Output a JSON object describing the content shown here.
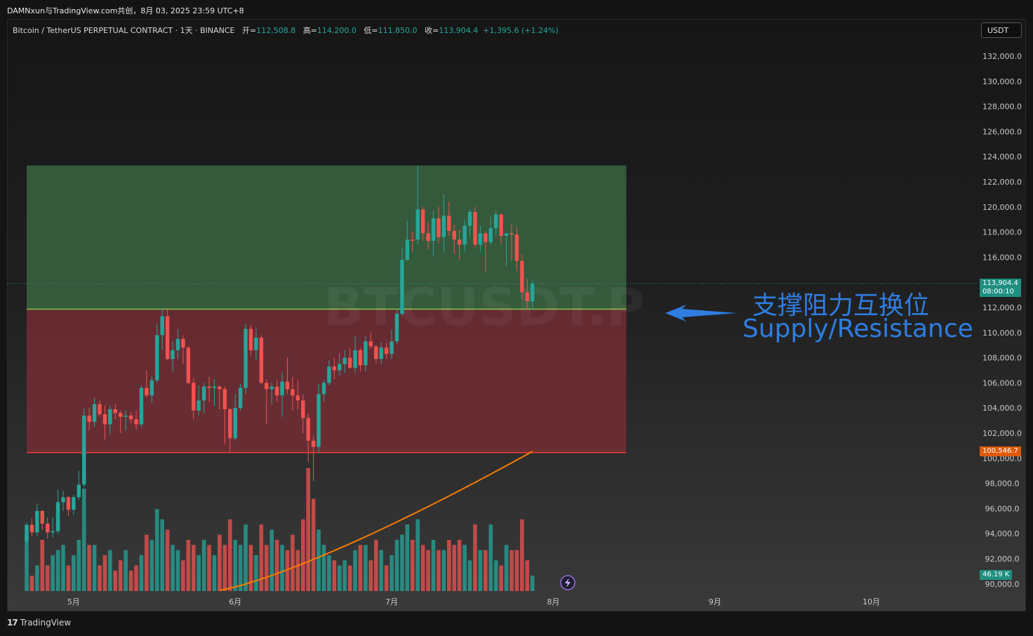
{
  "header": {
    "title": "DAMNxun与TradingView.com共创，8月 03, 2025 23:59 UTC+8"
  },
  "legend": {
    "symbol": "Bitcoin / TetherUS PERPETUAL CONTRACT · 1天 · BINANCE",
    "open_label": "开=",
    "open": "112,508.8",
    "high_label": "高=",
    "high": "114,200.0",
    "low_label": "低=",
    "low": "111,850.0",
    "close_label": "收=",
    "close": "113,904.4",
    "change": "+1,395.6 (+1.24%)"
  },
  "currency_button": "USDT",
  "watermark": "BTCUSDT.P",
  "annotation": {
    "cn": "支撑阻力互换位",
    "en": "Supply/Resistance"
  },
  "price_labels": {
    "last_price": "113,904.4",
    "countdown": "08:00:10",
    "ma_value": "100,546.7",
    "volume_value": "46.19 K"
  },
  "footer": {
    "brand": "TradingView",
    "logo": "17"
  },
  "colors": {
    "up": "#26a69a",
    "down": "#ef5350",
    "ma": "#f57c00",
    "supply_zone": "#3c6a44",
    "demand_zone": "#7a2e36",
    "annotation": "#2f7de1"
  },
  "chart_data": {
    "type": "candlestick",
    "interval": "1天",
    "y_axis": {
      "ticks": [
        "132,000.0",
        "130,000.0",
        "128,000.0",
        "126,000.0",
        "124,000.0",
        "122,000.0",
        "120,000.0",
        "118,000.0",
        "116,000.0",
        "114,000.0",
        "112,000.0",
        "110,000.0",
        "108,000.0",
        "106,000.0",
        "104,000.0",
        "102,000.0",
        "100,000.0",
        "98,000.0",
        "96,000.0",
        "94,000.0",
        "92,000.0",
        "90,000.0"
      ],
      "ylim": [
        89500,
        133500
      ]
    },
    "x_axis": {
      "ticks": [
        "5月",
        "6月",
        "7月",
        "8月",
        "9月",
        "10月"
      ]
    },
    "zones": [
      {
        "name": "upper",
        "top": 123300,
        "bottom": 111870,
        "start": "2025-04-22",
        "end": "2025-08-15"
      },
      {
        "name": "lower",
        "top": 111870,
        "bottom": 100450,
        "start": "2025-04-22",
        "end": "2025-08-15"
      }
    ],
    "start_date": "2025-04-22",
    "candles": [
      [
        93440,
        94860,
        93200,
        94700
      ],
      [
        94700,
        95200,
        93800,
        94100
      ],
      [
        94100,
        96400,
        93800,
        95800
      ],
      [
        95800,
        95900,
        94300,
        94800
      ],
      [
        94800,
        95300,
        93600,
        94100
      ],
      [
        94100,
        95300,
        93700,
        94200
      ],
      [
        94200,
        97500,
        94000,
        96500
      ],
      [
        96500,
        97400,
        95800,
        96900
      ],
      [
        96900,
        97000,
        95400,
        95900
      ],
      [
        95900,
        97100,
        95500,
        96900
      ],
      [
        96900,
        99000,
        96700,
        97900
      ],
      [
        97900,
        104000,
        97700,
        103400
      ],
      [
        103400,
        104000,
        102200,
        102900
      ],
      [
        102900,
        104800,
        102500,
        104300
      ],
      [
        104300,
        104600,
        103300,
        103500
      ],
      [
        103500,
        104200,
        101500,
        102700
      ],
      [
        102700,
        104200,
        101900,
        103900
      ],
      [
        103900,
        104300,
        103100,
        103600
      ],
      [
        103600,
        103800,
        102000,
        103300
      ],
      [
        103300,
        103800,
        102200,
        103400
      ],
      [
        103400,
        103700,
        102800,
        103100
      ],
      [
        103100,
        103800,
        102300,
        102700
      ],
      [
        102700,
        105800,
        102500,
        105600
      ],
      [
        105600,
        107000,
        104800,
        105000
      ],
      [
        105000,
        106500,
        104400,
        106200
      ],
      [
        106200,
        110700,
        106000,
        109800
      ],
      [
        109800,
        111900,
        108600,
        111300
      ],
      [
        111300,
        111900,
        107800,
        107900
      ],
      [
        107900,
        109300,
        106900,
        108600
      ],
      [
        108600,
        110300,
        107900,
        109500
      ],
      [
        109500,
        109800,
        107500,
        108800
      ],
      [
        108800,
        108900,
        105900,
        106000
      ],
      [
        106000,
        106400,
        103100,
        103800
      ],
      [
        103800,
        105800,
        103400,
        104600
      ],
      [
        104600,
        106000,
        103600,
        105700
      ],
      [
        105700,
        106500,
        104500,
        105600
      ],
      [
        105600,
        106300,
        104200,
        105700
      ],
      [
        105700,
        105800,
        103900,
        105500
      ],
      [
        105500,
        105700,
        101100,
        103900
      ],
      [
        103900,
        104000,
        100400,
        101600
      ],
      [
        101600,
        105100,
        101400,
        104000
      ],
      [
        104000,
        105900,
        103800,
        105600
      ],
      [
        105600,
        110700,
        105100,
        110300
      ],
      [
        110300,
        110600,
        108200,
        108600
      ],
      [
        108600,
        110400,
        107800,
        109600
      ],
      [
        109600,
        109800,
        105900,
        106000
      ],
      [
        106000,
        106300,
        102700,
        105500
      ],
      [
        105500,
        106000,
        104300,
        105700
      ],
      [
        105700,
        106200,
        104500,
        105000
      ],
      [
        105000,
        106800,
        103300,
        106100
      ],
      [
        106100,
        108000,
        105100,
        105500
      ],
      [
        105500,
        106500,
        103800,
        105000
      ],
      [
        105000,
        106200,
        103900,
        104600
      ],
      [
        104600,
        105100,
        102000,
        103200
      ],
      [
        103200,
        103600,
        99700,
        101400
      ],
      [
        101400,
        101800,
        98200,
        100900
      ],
      [
        100900,
        105900,
        100500,
        105100
      ],
      [
        105100,
        106200,
        104500,
        106000
      ],
      [
        106000,
        107800,
        105800,
        107300
      ],
      [
        107300,
        108000,
        106300,
        107000
      ],
      [
        107000,
        108400,
        106600,
        107500
      ],
      [
        107500,
        108600,
        106800,
        108000
      ],
      [
        108000,
        108800,
        107100,
        107200
      ],
      [
        107200,
        109700,
        106800,
        108600
      ],
      [
        108600,
        108800,
        106900,
        107400
      ],
      [
        107400,
        109700,
        106900,
        109300
      ],
      [
        109300,
        110000,
        108700,
        108900
      ],
      [
        108900,
        109000,
        107600,
        107900
      ],
      [
        107900,
        109200,
        107500,
        108800
      ],
      [
        108800,
        109200,
        107900,
        108300
      ],
      [
        108300,
        110200,
        107900,
        109300
      ],
      [
        109300,
        111900,
        109100,
        111500
      ],
      [
        111500,
        116800,
        111300,
        115800
      ],
      [
        115800,
        118900,
        115700,
        117400
      ],
      [
        117400,
        118000,
        116400,
        117300
      ],
      [
        117400,
        123300,
        117000,
        119800
      ],
      [
        119800,
        120000,
        117300,
        117900
      ],
      [
        117900,
        118800,
        116600,
        117300
      ],
      [
        117300,
        119700,
        116100,
        119100
      ],
      [
        119100,
        120000,
        117100,
        117600
      ],
      [
        117600,
        121000,
        116400,
        119300
      ],
      [
        119300,
        120400,
        117700,
        118100
      ],
      [
        118100,
        118600,
        116300,
        117400
      ],
      [
        117400,
        118200,
        115800,
        117000
      ],
      [
        117000,
        119000,
        116400,
        118500
      ],
      [
        118500,
        119800,
        117600,
        119600
      ],
      [
        119600,
        120000,
        116800,
        117000
      ],
      [
        117000,
        118500,
        116400,
        117900
      ],
      [
        117900,
        118100,
        114800,
        117200
      ],
      [
        117200,
        119200,
        117000,
        118300
      ],
      [
        118300,
        119700,
        117700,
        119400
      ],
      [
        119400,
        119500,
        117000,
        117700
      ],
      [
        117700,
        117800,
        115300,
        117900
      ],
      [
        117900,
        118600,
        115700,
        117800
      ],
      [
        117800,
        118400,
        114900,
        115700
      ],
      [
        115700,
        116200,
        112600,
        113200
      ],
      [
        113200,
        114300,
        111800,
        112500
      ],
      [
        112500,
        114200,
        111850,
        113904
      ]
    ],
    "volume": [
      11,
      3,
      5,
      10,
      5,
      7,
      8,
      9,
      5,
      7,
      10,
      20,
      9,
      9,
      5,
      7,
      8,
      4,
      6,
      8,
      4,
      5,
      7,
      11,
      10,
      16,
      14,
      12,
      9,
      8,
      6,
      10,
      9,
      7,
      10,
      9,
      7,
      11,
      9,
      14,
      10,
      9,
      13,
      9,
      7,
      13,
      9,
      12,
      10,
      9,
      8,
      11,
      8,
      14,
      24,
      18,
      12,
      9,
      7,
      6,
      5,
      6,
      5,
      8,
      9,
      9,
      6,
      10,
      8,
      5,
      7,
      10,
      11,
      13,
      10,
      14,
      9,
      8,
      10,
      8,
      8,
      10,
      9,
      10,
      9,
      6,
      13,
      8,
      8,
      13,
      6,
      5,
      9,
      8,
      8,
      14,
      6,
      3
    ],
    "ma_series_name": "",
    "ma_current": 100546.7
  }
}
